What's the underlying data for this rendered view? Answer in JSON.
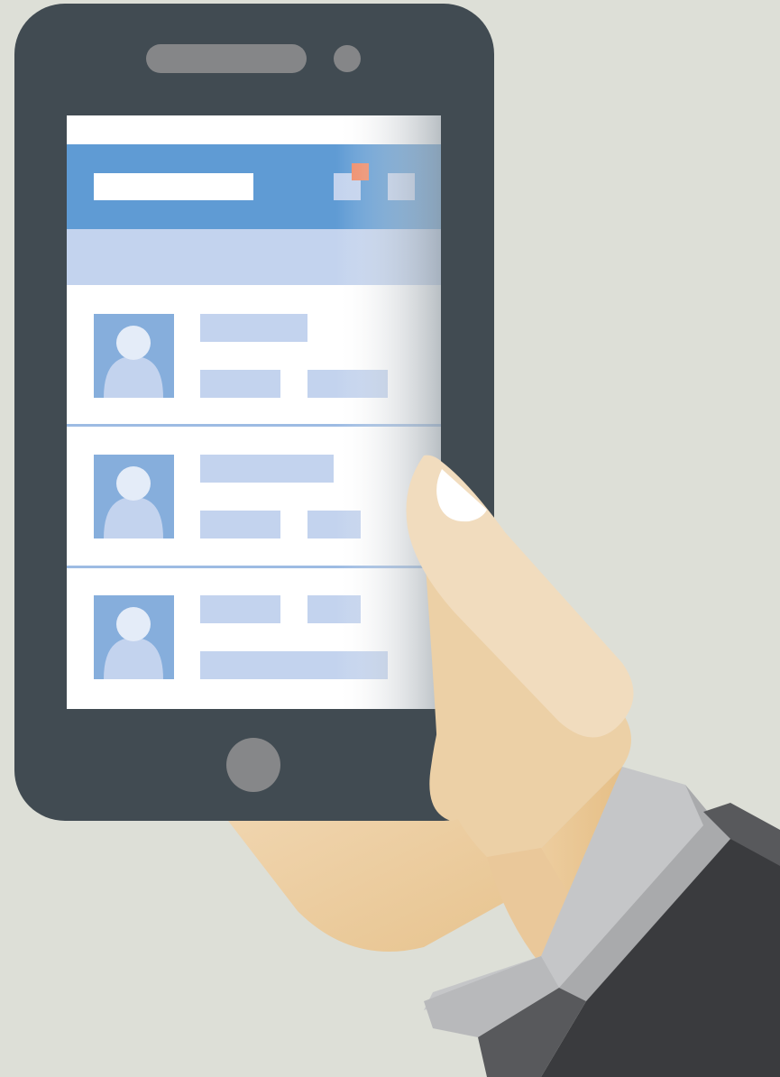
{
  "colors": {
    "background": "#dddfd7",
    "phone_body": "#414b52",
    "phone_shade": "#2f373d",
    "speaker": "#858688",
    "home_button": "#868789",
    "screen_bg": "#ffffff",
    "app_bar": "#5f9bd4",
    "sub_bar": "#c3d3ee",
    "placeholder": "#c3d3ee",
    "avatar_bg": "#86aedc",
    "avatar_head": "#e4ecf8",
    "avatar_body": "#c3d3ee",
    "divider": "#9dbbe3",
    "notification_dot": "#f08a66",
    "skin_light": "#f1dcbe",
    "skin_mid": "#ecd0a6",
    "skin_dark": "#e3ba7e",
    "nail": "#ffffff",
    "cuff_light": "#c5c6c8",
    "cuff_dark": "#a9aaac",
    "sleeve": "#3a3b3e",
    "sleeve_light": "#58595c"
  },
  "icons": {
    "notification": "bell-icon",
    "menu": "menu-icon",
    "avatar": "user-avatar-icon"
  },
  "list": {
    "items": [
      {
        "name": "contact-1"
      },
      {
        "name": "contact-2"
      },
      {
        "name": "contact-3"
      }
    ]
  }
}
